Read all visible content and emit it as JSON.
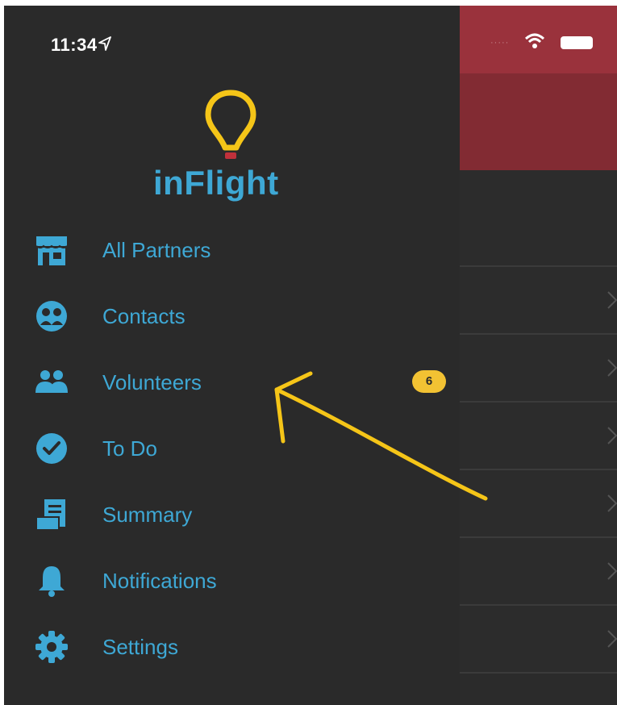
{
  "status_bar": {
    "time": "11:34"
  },
  "app": {
    "name": "inFlight"
  },
  "menu": [
    {
      "label": "All Partners",
      "icon": "storefront-icon"
    },
    {
      "label": "Contacts",
      "icon": "contacts-icon"
    },
    {
      "label": "Volunteers",
      "icon": "volunteers-icon",
      "badge": "6"
    },
    {
      "label": "To Do",
      "icon": "check-circle-icon"
    },
    {
      "label": "Summary",
      "icon": "summary-icon"
    },
    {
      "label": "Notifications",
      "icon": "bell-icon"
    },
    {
      "label": "Settings",
      "icon": "gear-icon"
    }
  ],
  "colors": {
    "accent": "#3ea8d5",
    "badge": "#f2c233",
    "drawer_bg": "#2a2a2a",
    "header_red": "#9a323c",
    "annotation": "#f5c518"
  }
}
